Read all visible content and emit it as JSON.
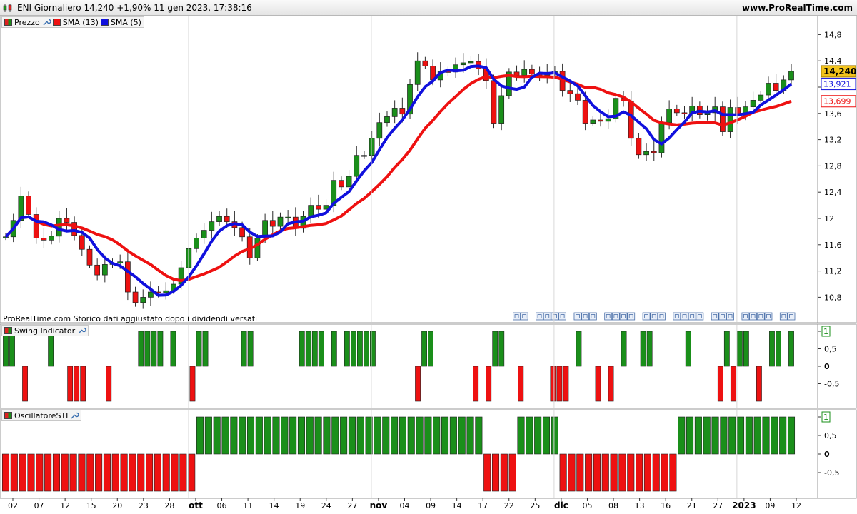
{
  "header": {
    "title": "ENI Giornaliero 14,240 +1,90% 11 gen 2023, 17:38:16",
    "site": "www.ProRealTime.com",
    "icon": "candlestick-icon"
  },
  "legend": {
    "price": "Prezzo",
    "sma13": "SMA (13)",
    "sma5": "SMA (5)",
    "swing": "Swing Indicator",
    "osc": "OscillatoreSTI",
    "icon": "wrench-icon"
  },
  "footnote": "ProRealTime.com Storico dati aggiustato dopo i dividendi versati",
  "colors": {
    "up": "#1a8f1a",
    "down": "#ee1111",
    "sma13": "#ee1111",
    "sma5": "#1010dd",
    "last_price_bg": "#f2c31c"
  },
  "chart_data": [
    {
      "type": "candlestick",
      "title": "ENI Giornaliero",
      "ylim": [
        10.5,
        15.0
      ],
      "yticks": [
        "14,8",
        "14,4",
        "14",
        "13,6",
        "13,2",
        "12,8",
        "12,4",
        "12",
        "11,6",
        "11,2",
        "10,8"
      ],
      "ytick_values": [
        14.8,
        14.4,
        14.0,
        13.6,
        13.2,
        12.8,
        12.4,
        12.0,
        11.6,
        11.2,
        10.8
      ],
      "close": [
        11.72,
        11.97,
        12.34,
        12.06,
        11.7,
        11.67,
        11.73,
        12.0,
        11.94,
        11.74,
        11.53,
        11.29,
        11.14,
        11.3,
        11.32,
        11.34,
        10.88,
        10.72,
        10.8,
        10.88,
        10.87,
        10.9,
        11.0,
        11.25,
        11.54,
        11.7,
        11.82,
        11.95,
        12.03,
        11.95,
        11.86,
        11.72,
        11.4,
        11.7,
        11.97,
        11.88,
        12.02,
        12.02,
        11.85,
        12.03,
        12.2,
        12.14,
        12.2,
        12.58,
        12.48,
        12.64,
        12.96,
        12.96,
        13.22,
        13.46,
        13.55,
        13.68,
        13.59,
        14.04,
        14.4,
        14.32,
        14.11,
        14.24,
        14.23,
        14.34,
        14.37,
        14.39,
        14.28,
        14.1,
        13.45,
        13.87,
        14.23,
        14.18,
        14.27,
        14.2,
        14.18,
        14.2,
        14.24,
        13.95,
        13.9,
        13.8,
        13.45,
        13.5,
        13.48,
        13.52,
        13.83,
        13.79,
        13.22,
        12.97,
        13.02,
        13.0,
        13.46,
        13.67,
        13.61,
        13.6,
        13.71,
        13.58,
        13.61,
        13.7,
        13.32,
        13.69,
        13.57,
        13.7,
        13.8,
        13.88,
        14.06,
        13.95,
        14.11,
        14.24
      ],
      "open": [
        11.72,
        11.72,
        11.97,
        12.34,
        12.06,
        11.7,
        11.67,
        11.73,
        12.0,
        11.94,
        11.74,
        11.53,
        11.29,
        11.14,
        11.3,
        11.32,
        11.34,
        10.88,
        10.72,
        10.8,
        10.88,
        10.87,
        10.9,
        11.0,
        11.25,
        11.54,
        11.7,
        11.82,
        11.95,
        12.03,
        11.95,
        11.86,
        11.72,
        11.4,
        11.7,
        11.97,
        11.88,
        12.02,
        12.02,
        11.85,
        12.03,
        12.2,
        12.14,
        12.2,
        12.58,
        12.48,
        12.64,
        12.96,
        12.96,
        13.22,
        13.46,
        13.55,
        13.68,
        13.59,
        14.04,
        14.4,
        14.32,
        14.11,
        14.24,
        14.23,
        14.34,
        14.37,
        14.39,
        14.28,
        14.1,
        13.45,
        13.87,
        14.23,
        14.18,
        14.27,
        14.2,
        14.18,
        14.2,
        14.24,
        13.95,
        13.9,
        13.8,
        13.45,
        13.5,
        13.48,
        13.52,
        13.83,
        13.79,
        13.22,
        12.97,
        13.02,
        13.0,
        13.46,
        13.67,
        13.61,
        13.6,
        13.71,
        13.58,
        13.61,
        13.7,
        13.32,
        13.69,
        13.57,
        13.7,
        13.8,
        13.88,
        14.06,
        13.95,
        14.11
      ],
      "sma13_last": "13,699",
      "sma5_last": "13,921",
      "last_price": "14,240",
      "xticks": [
        "02",
        "07",
        "12",
        "15",
        "20",
        "23",
        "28",
        "ott",
        "06",
        "11",
        "14",
        "19",
        "24",
        "27",
        "nov",
        "04",
        "09",
        "14",
        "17",
        "22",
        "25",
        "dic",
        "05",
        "08",
        "13",
        "16",
        "21",
        "27",
        "2023",
        "09",
        "12"
      ],
      "xtick_bold": [
        "ott",
        "nov",
        "dic",
        "2023"
      ],
      "dividend_markers": 29
    },
    {
      "type": "bar",
      "title": "Swing Indicator",
      "ylim": [
        -1,
        1
      ],
      "yticks": [
        "1",
        "0,5",
        "0",
        "-0,5"
      ],
      "ytick_values": [
        1,
        0.5,
        0,
        -0.5
      ],
      "values": [
        1,
        1,
        0,
        -1,
        0,
        0,
        0,
        1,
        0,
        0,
        -1,
        -1,
        -1,
        0,
        0,
        0,
        -1,
        0,
        0,
        0,
        0,
        1,
        1,
        1,
        1,
        0,
        1,
        0,
        0,
        -1,
        1,
        1,
        0,
        0,
        0,
        0,
        0,
        1,
        1,
        0,
        0,
        0,
        0,
        0,
        0,
        0,
        1,
        1,
        1,
        1,
        0,
        1,
        0,
        1,
        1,
        1,
        1,
        1,
        0,
        0,
        0,
        0,
        0,
        0,
        -1,
        1,
        1,
        0,
        0,
        0,
        0,
        0,
        0,
        -1,
        0,
        -1,
        1,
        1,
        0,
        0,
        -1,
        0,
        0,
        0,
        0,
        -1,
        -1,
        -1,
        0,
        1,
        0,
        0,
        -1,
        0,
        -1,
        0,
        1,
        0,
        0,
        1,
        1,
        0,
        0,
        0,
        0,
        0,
        1,
        0,
        0,
        0,
        0,
        -1,
        1,
        -1,
        1,
        1,
        0,
        -1,
        0,
        1,
        1,
        0,
        1
      ]
    },
    {
      "type": "bar",
      "title": "OscillatoreSTI",
      "ylim": [
        -1,
        1
      ],
      "yticks": [
        "1",
        "0,5",
        "0",
        "-0,5"
      ],
      "ytick_values": [
        1,
        0.5,
        0,
        -0.5
      ],
      "values": [
        -1,
        -1,
        -1,
        -1,
        -1,
        -1,
        -1,
        -1,
        -1,
        -1,
        -1,
        -1,
        -1,
        -1,
        -1,
        -1,
        -1,
        -1,
        -1,
        -1,
        -1,
        -1,
        -1,
        1,
        1,
        1,
        1,
        1,
        1,
        1,
        1,
        1,
        1,
        1,
        1,
        1,
        1,
        1,
        1,
        1,
        1,
        1,
        1,
        1,
        1,
        1,
        1,
        1,
        1,
        1,
        1,
        1,
        1,
        1,
        1,
        1,
        1,
        -1,
        -1,
        -1,
        -1,
        1,
        1,
        1,
        1,
        1,
        -1,
        -1,
        -1,
        -1,
        -1,
        -1,
        -1,
        -1,
        -1,
        -1,
        -1,
        -1,
        -1,
        -1,
        1,
        1,
        1,
        1,
        1,
        1,
        1,
        1,
        1,
        1,
        1,
        1,
        1,
        1
      ]
    }
  ]
}
